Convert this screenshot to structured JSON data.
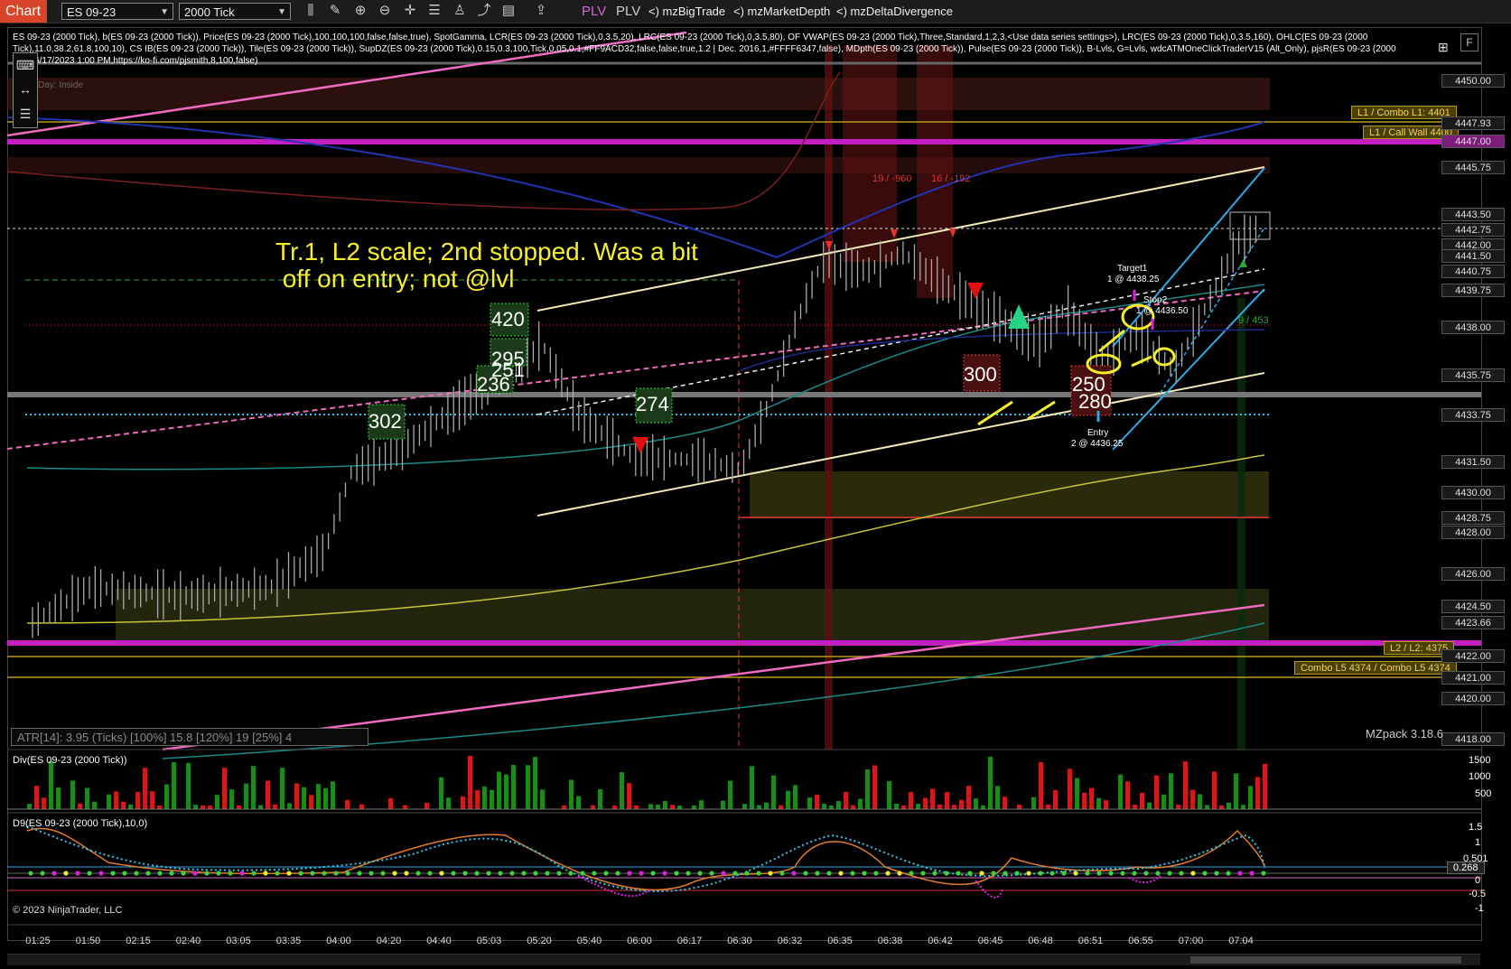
{
  "toolbar": {
    "tab": "Chart",
    "instrument": "ES 09-23",
    "interval": "2000 Tick",
    "plv1": "PLV",
    "plv2": "PLV",
    "big_trade": "<) mzBigTrade",
    "market_depth": "<) mzMarketDepth",
    "delta_div": "<) mzDeltaDivergence",
    "icons": [
      "bars-icon",
      "draw-icon",
      "zoom-in-icon",
      "zoom-out-icon",
      "properties-icon",
      "crosshair-icon",
      "strategies-icon",
      "indicators-icon",
      "templates-icon",
      "share-icon"
    ]
  },
  "header": {
    "indicators_line": "ES 09-23 (2000 Tick), b(ES 09-23 (2000 Tick)), Price(ES 09-23 (2000 Tick),100,100,100,false,false,true), SpotGamma, LCR(ES 09-23 (2000 Tick),0,3.5,20), LRC(ES 09-23 (2000 Tick),0,3.5,80), OF VWAP(ES 09-23 (2000 Tick),Three,Standard,1,2,3,<Use data series settings>), LRC(ES 09-23 (2000 Tick),0,3.5,160), OHLC(ES 09-23 (2000 Tick),11.0,38.2,61.8,100,10), CS IB(ES 09-23 (2000 Tick)), Tile(ES 09-23 (2000 Tick)), SupDZ(ES 09-23 (2000 Tick),0.15,0.3,100,Tick,0.05,0.1,#FF9ACD32,false,false,true,1.2 | Dec. 2016,1,#FFFF6347,false), MDpth(ES 09-23 (2000 Tick)), Pulse(ES 09-23 (2000 Tick)), B-Lvls, G=Lvls, wdcATMOneClickTraderV15 (Alt_Only), pjsR(ES 09-23 (2000 Tick),6/17/2023 1:00 PM,https://ko-fi.com/pjsmith,8,100,false)",
    "day_label": "Day: Inside"
  },
  "annotation": {
    "line1": "Tr.1, L2 scale; 2nd stopped. Was a bit",
    "line2": " off on entry; not @lvl"
  },
  "level_labels": {
    "combo_l1": "L1 / Combo L1: 4401",
    "call_wall": "L1 / Call Wall 4400",
    "l2": "L2 / L2: 4375",
    "combo_l5": "Combo L5 4374 / Combo L5 4374"
  },
  "price_axis": [
    "4450.00",
    "4447.93",
    "4447.00",
    "4445.75",
    "4443.50",
    "4442.75",
    "4442.00",
    "4441.50",
    "4440.75",
    "4439.75",
    "4438.00",
    "4435.75",
    "4433.75",
    "4431.50",
    "4430.00",
    "4428.75",
    "4428.00",
    "4426.00",
    "4424.50",
    "4423.66",
    "4422.00",
    "4421.00",
    "4420.00",
    "4418.00"
  ],
  "volume_boxes": [
    "420",
    "295",
    "251",
    "236",
    "302",
    "274",
    "300",
    "250",
    "280"
  ],
  "trade": {
    "target1": "Target1",
    "target1_detail": "1 @ 4438.25",
    "stop2": "Stop2",
    "stop2_detail": "1 @ 4436.50",
    "entry": "Entry",
    "entry_detail": "2 @ 4436.25"
  },
  "red_labels": [
    "19 / -960",
    "16 / -192"
  ],
  "green_label": "9 / 453",
  "atr": "ATR[14]: 3.95 (Ticks) [100%] 15.8 [120%] 19 [25%] 4",
  "mzpack": "MZpack 3.18.6",
  "div_panel": {
    "title": "Div(ES 09-23 (2000 Tick))",
    "axis": [
      "1500",
      "1000",
      "500"
    ]
  },
  "d9_panel": {
    "title": "D9(ES 09-23 (2000 Tick),10,0)",
    "axis": [
      "1.5",
      "1",
      "0.501",
      "0.268",
      "0",
      "-0.5",
      "-1"
    ]
  },
  "copyright": "© 2023 NinjaTrader, LLC",
  "time_axis": [
    "01:25",
    "01:50",
    "02:15",
    "02:40",
    "03:05",
    "03:35",
    "04:00",
    "04:20",
    "04:40",
    "05:03",
    "05:20",
    "05:40",
    "06:00",
    "06:17",
    "06:30",
    "06:32",
    "06:35",
    "06:38",
    "06:42",
    "06:45",
    "06:48",
    "06:51",
    "06:55",
    "07:00",
    "07:04"
  ],
  "colors": {
    "tab": "#d9452b",
    "magenta_level": "#c21ec2",
    "annotation": "#f7ef2a",
    "up_bar": "#1e8a1e",
    "down_bar": "#d11a1a"
  }
}
